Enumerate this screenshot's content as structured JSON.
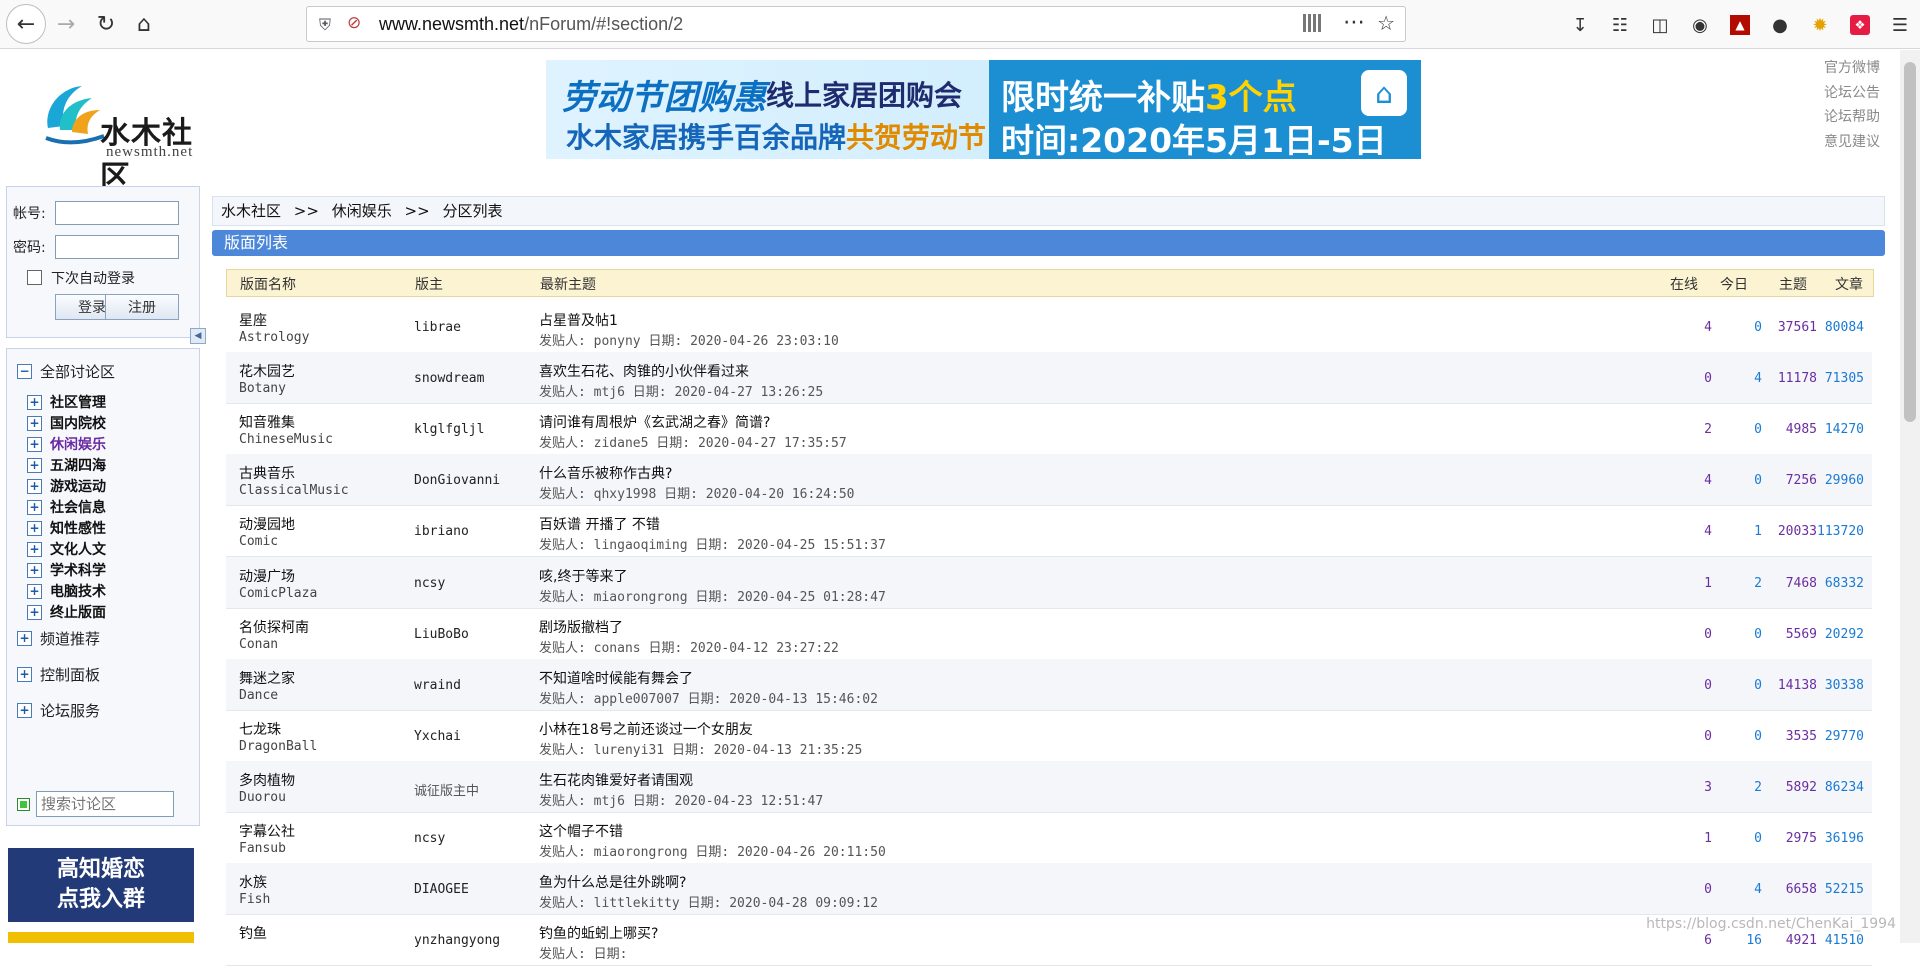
{
  "browser": {
    "url_host": "www.newsmth.net",
    "url_path": "/nForum/#!section/2"
  },
  "header": {
    "logo_cn": "水木社区",
    "logo_en": "newsmth.net",
    "top_links": [
      "官方微博",
      "论坛公告",
      "论坛帮助",
      "意见建议"
    ]
  },
  "banner": {
    "line1_title": "劳动节团购惠",
    "line1_sub": "线上家居团购会",
    "line2_a": "水木家居携手百余品牌",
    "line2_b": "共贺劳动节",
    "right1_a": "限时统一补贴",
    "right1_b": "3个点",
    "right2": "时间:2020年5月1日-5日"
  },
  "login": {
    "account_label": "帐号:",
    "password_label": "密码:",
    "remember_label": "下次自动登录",
    "login_button": "登录",
    "register_button": "注册"
  },
  "nav": {
    "all_label": "全部讨论区",
    "sections": [
      {
        "label": "社区管理",
        "active": false
      },
      {
        "label": "国内院校",
        "active": false
      },
      {
        "label": "休闲娱乐",
        "active": true
      },
      {
        "label": "五湖四海",
        "active": false
      },
      {
        "label": "游戏运动",
        "active": false
      },
      {
        "label": "社会信息",
        "active": false
      },
      {
        "label": "知性感性",
        "active": false
      },
      {
        "label": "文化人文",
        "active": false
      },
      {
        "label": "学术科学",
        "active": false
      },
      {
        "label": "电脑技术",
        "active": false
      },
      {
        "label": "终止版面",
        "active": false
      }
    ],
    "channel_label": "频道推荐",
    "control_label": "控制面板",
    "service_label": "论坛服务",
    "search_placeholder": "搜索讨论区"
  },
  "ad": {
    "line1": "高知婚恋",
    "line2": "点我入群"
  },
  "breadcrumb": {
    "home": "水木社区",
    "sep": ">>",
    "section": "休闲娱乐",
    "page": "分区列表"
  },
  "panel": {
    "title": "版面列表"
  },
  "table": {
    "headers": {
      "name": "版面名称",
      "moderator": "版主",
      "latest": "最新主题",
      "online": "在线",
      "today": "今日",
      "topics": "主题",
      "posts": "文章"
    },
    "rows": [
      {
        "cn": "星座",
        "en": "Astrology",
        "mod": "librae",
        "topic": "占星普及帖1",
        "poster_label": "发贴人:",
        "poster": "ponyny",
        "date_label": "日期:",
        "date": "2020-04-26 23:03:10",
        "online": "4",
        "today": "0",
        "topics": "37561",
        "posts": "80084"
      },
      {
        "cn": "花木园艺",
        "en": "Botany",
        "mod": "snowdream",
        "topic": "喜欢生石花、肉锥的小伙伴看过来",
        "poster_label": "发贴人:",
        "poster": "mtj6",
        "date_label": "日期:",
        "date": "2020-04-27 13:26:25",
        "online": "0",
        "today": "4",
        "topics": "11178",
        "posts": "71305"
      },
      {
        "cn": "知音雅集",
        "en": "ChineseMusic",
        "mod": "klglfgljl",
        "topic": "请问谁有周根炉《玄武湖之春》简谱?",
        "poster_label": "发贴人:",
        "poster": "zidane5",
        "date_label": "日期:",
        "date": "2020-04-27 17:35:57",
        "online": "2",
        "today": "0",
        "topics": "4985",
        "posts": "14270"
      },
      {
        "cn": "古典音乐",
        "en": "ClassicalMusic",
        "mod": "DonGiovanni",
        "topic": "什么音乐被称作古典?",
        "poster_label": "发贴人:",
        "poster": "qhxy1998",
        "date_label": "日期:",
        "date": "2020-04-20 16:24:50",
        "online": "4",
        "today": "0",
        "topics": "7256",
        "posts": "29960"
      },
      {
        "cn": "动漫园地",
        "en": "Comic",
        "mod": "ibriano",
        "topic": "百妖谱 开播了 不错",
        "poster_label": "发贴人:",
        "poster": "lingaoqiming",
        "date_label": "日期:",
        "date": "2020-04-25 15:51:37",
        "online": "4",
        "today": "1",
        "topics": "20033",
        "posts": "113720"
      },
      {
        "cn": "动漫广场",
        "en": "ComicPlaza",
        "mod": "ncsy",
        "topic": "咳,终于等来了",
        "poster_label": "发贴人:",
        "poster": "miaorongrong",
        "date_label": "日期:",
        "date": "2020-04-25 01:28:47",
        "online": "1",
        "today": "2",
        "topics": "7468",
        "posts": "68332"
      },
      {
        "cn": "名侦探柯南",
        "en": "Conan",
        "mod": "LiuBoBo",
        "topic": "剧场版撤档了",
        "poster_label": "发贴人:",
        "poster": "conans",
        "date_label": "日期:",
        "date": "2020-04-12 23:27:22",
        "online": "0",
        "today": "0",
        "topics": "5569",
        "posts": "20292"
      },
      {
        "cn": "舞迷之家",
        "en": "Dance",
        "mod": "wraind",
        "topic": "不知道啥时候能有舞会了",
        "poster_label": "发贴人:",
        "poster": "apple007007",
        "date_label": "日期:",
        "date": "2020-04-13 15:46:02",
        "online": "0",
        "today": "0",
        "topics": "14138",
        "posts": "30338"
      },
      {
        "cn": "七龙珠",
        "en": "DragonBall",
        "mod": "Yxchai",
        "topic": "小林在18号之前还谈过一个女朋友",
        "poster_label": "发贴人:",
        "poster": "lurenyi31",
        "date_label": "日期:",
        "date": "2020-04-13 21:35:25",
        "online": "0",
        "today": "0",
        "topics": "3535",
        "posts": "29770"
      },
      {
        "cn": "多肉植物",
        "en": "Duorou",
        "mod": "诚征版主中",
        "topic": "生石花肉锥爱好者请围观",
        "poster_label": "发贴人:",
        "poster": "mtj6",
        "date_label": "日期:",
        "date": "2020-04-23 12:51:47",
        "online": "3",
        "today": "2",
        "topics": "5892",
        "posts": "86234"
      },
      {
        "cn": "字幕公社",
        "en": "Fansub",
        "mod": "ncsy",
        "topic": "这个帽子不错",
        "poster_label": "发贴人:",
        "poster": "miaorongrong",
        "date_label": "日期:",
        "date": "2020-04-26 20:11:50",
        "online": "1",
        "today": "0",
        "topics": "2975",
        "posts": "36196"
      },
      {
        "cn": "水族",
        "en": "Fish",
        "mod": "DIAOGEE",
        "topic": "鱼为什么总是往外跳啊?",
        "poster_label": "发贴人:",
        "poster": "littlekitty",
        "date_label": "日期:",
        "date": "2020-04-28 09:09:12",
        "online": "0",
        "today": "4",
        "topics": "6658",
        "posts": "52215"
      },
      {
        "cn": "钓鱼",
        "en": "",
        "mod": "ynzhangyong",
        "topic": "钓鱼的蚯蚓上哪买?",
        "poster_label": "发贴人:",
        "poster": "",
        "date_label": "日期:",
        "date": "",
        "online": "6",
        "today": "16",
        "topics": "4921",
        "posts": "41510"
      }
    ]
  },
  "watermark": "https://blog.csdn.net/ChenKai_1994",
  "colors": {
    "panel_head": "#4d87d9",
    "thead_bg": "#fcf3d2",
    "num_purple": "#6b2da0",
    "num_blue": "#1a7ad4",
    "active_nav": "#6a2aa3"
  }
}
